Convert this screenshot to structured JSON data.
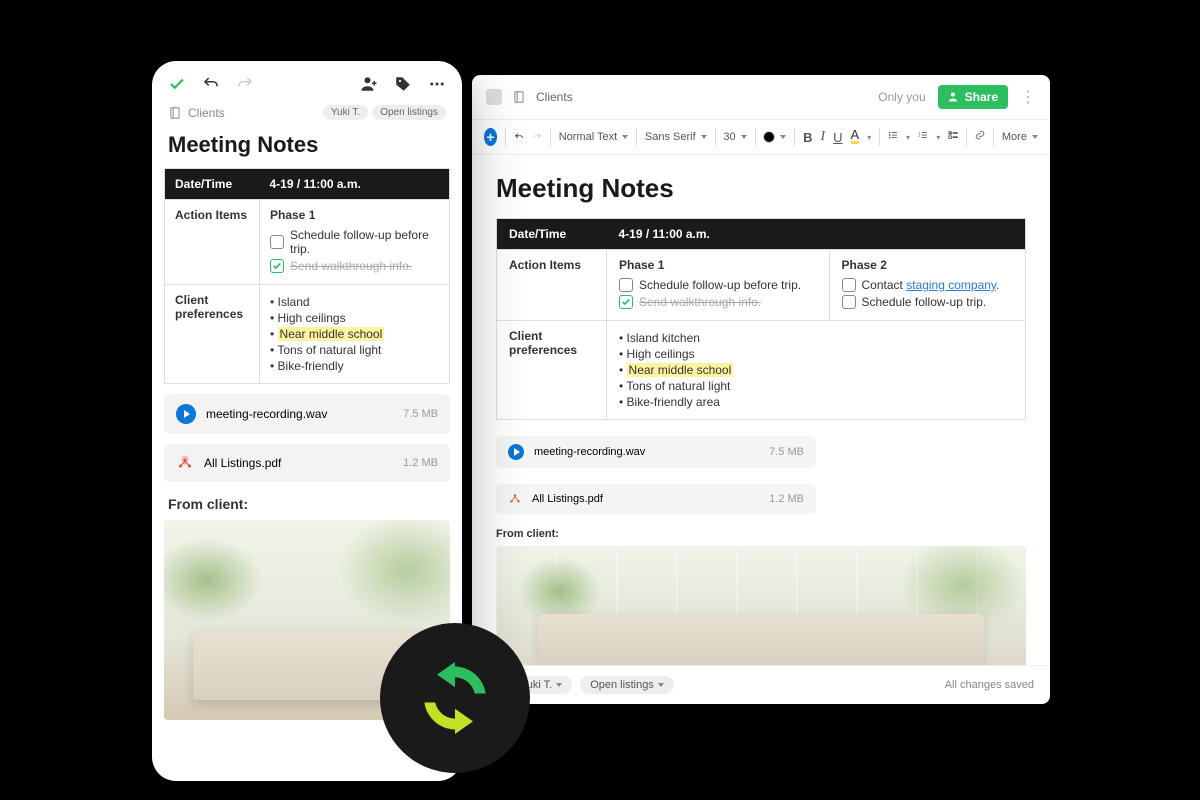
{
  "mobile": {
    "notebook": "Clients",
    "tags": [
      "Yuki T.",
      "Open listings"
    ],
    "title": "Meeting Notes",
    "table": {
      "header_datetime": "Date/Time",
      "datetime_value": "4-19 / 11:00 a.m.",
      "row_action_label": "Action Items",
      "phase1_label": "Phase 1",
      "task1": "Schedule follow-up before trip.",
      "task2": "Send walkthrough info.",
      "row_prefs_label": "Client preferences",
      "prefs": [
        "Island",
        "High ceilings",
        "Near middle school",
        "Tons of natural light",
        "Bike-friendly"
      ]
    },
    "att1_name": "meeting-recording.wav",
    "att1_size": "7.5 MB",
    "att2_name": "All Listings.pdf",
    "att2_size": "1.2 MB",
    "from_client": "From client:"
  },
  "desktop": {
    "notebook": "Clients",
    "only_you": "Only you",
    "share": "Share",
    "toolbar": {
      "style": "Normal Text",
      "font": "Sans Serif",
      "size": "30",
      "more": "More"
    },
    "title": "Meeting Notes",
    "table": {
      "header_datetime": "Date/Time",
      "datetime_value": "4-19 / 11:00 a.m.",
      "row_action_label": "Action Items",
      "phase1_label": "Phase 1",
      "p1_task1": "Schedule follow-up before trip.",
      "p1_task2": "Send walkthrough info.",
      "phase2_label": "Phase 2",
      "p2_task1_pre": "Contact ",
      "p2_task1_link": "staging company",
      "p2_task1_post": ".",
      "p2_task2": "Schedule follow-up trip.",
      "row_prefs_label": "Client preferences",
      "prefs": [
        "Island kitchen",
        "High ceilings",
        "Near middle school",
        "Tons of natural light",
        "Bike-friendly area"
      ]
    },
    "att1_name": "meeting-recording.wav",
    "att1_size": "7.5 MB",
    "att2_name": "All Listings.pdf",
    "att2_size": "1.2 MB",
    "from_client": "From client:",
    "footer": {
      "tag1": "Yuki T.",
      "tag2": "Open listings",
      "saved": "All changes saved"
    }
  }
}
